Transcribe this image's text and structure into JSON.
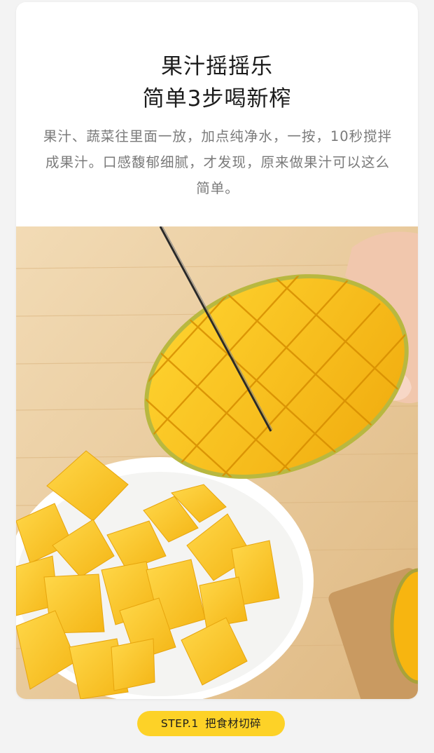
{
  "header": {
    "title_line1": "果汁摇摇乐",
    "title_line2": "简单3步喝新榨",
    "description": "果汁、蔬菜往里面一放，加点纯净水，一按，10秒搅拌成果汁。口感馥郁细腻，才发现，原来做果汁可以这么简单。"
  },
  "step": {
    "number_label": "STEP.1",
    "text": "把食材切碎"
  },
  "colors": {
    "accent": "#fdd227",
    "title": "#1c1c1c",
    "body_text": "#7a7a7a",
    "card_bg": "#ffffff",
    "page_bg": "#f3f3f3",
    "mango": "#f8c419",
    "wood": "#e8c99c"
  }
}
